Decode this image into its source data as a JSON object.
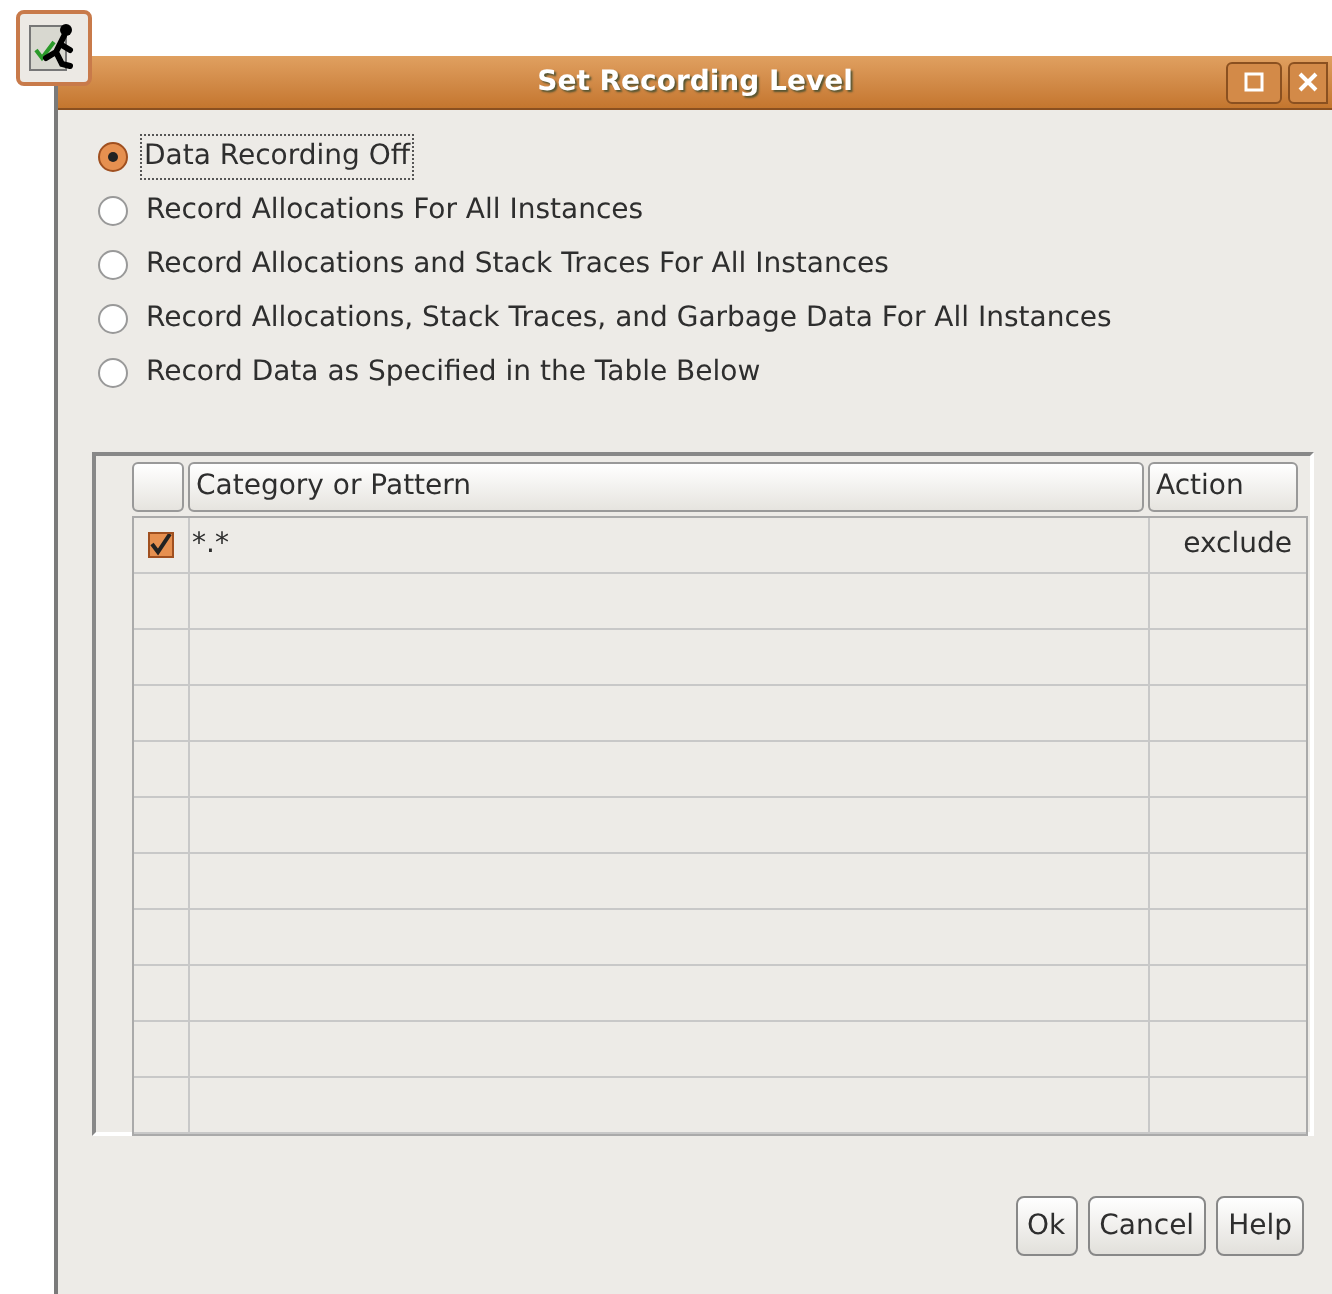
{
  "window": {
    "title": "Set Recording Level"
  },
  "options": [
    {
      "label": "Data Recording Off",
      "selected": true
    },
    {
      "label": "Record Allocations For All Instances",
      "selected": false
    },
    {
      "label": "Record Allocations and Stack Traces For All Instances",
      "selected": false
    },
    {
      "label": "Record Allocations, Stack Traces, and Garbage Data For All Instances",
      "selected": false
    },
    {
      "label": "Record Data as Specified in the Table Below",
      "selected": false
    }
  ],
  "table": {
    "columns": [
      "Category or Pattern",
      "Action"
    ],
    "rows": [
      {
        "checked": true,
        "pattern": "*.*",
        "action": "exclude"
      }
    ]
  },
  "buttons": [
    "Ok",
    "Cancel",
    "Help"
  ]
}
